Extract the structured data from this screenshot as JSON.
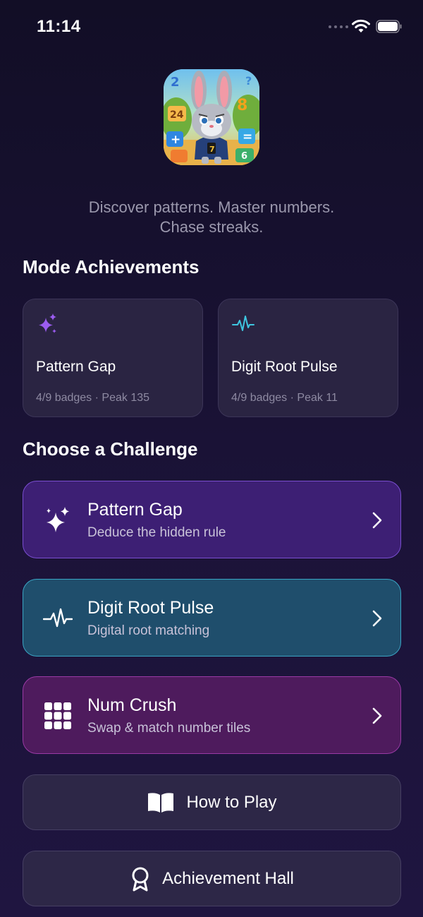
{
  "status": {
    "time": "11:14"
  },
  "header": {
    "tagline_line1": "Discover patterns. Master numbers.",
    "tagline_line2": "Chase streaks."
  },
  "achievements": {
    "title": "Mode Achievements",
    "cards": [
      {
        "name": "Pattern Gap",
        "stats": "4/9 badges · Peak 135",
        "icon": "sparkles-icon",
        "accent": "#9b5cf0"
      },
      {
        "name": "Digit Root Pulse",
        "stats": "4/9 badges · Peak 11",
        "icon": "pulse-icon",
        "accent": "#3ec6e0"
      }
    ]
  },
  "challenges": {
    "title": "Choose a Challenge",
    "items": [
      {
        "title": "Pattern Gap",
        "subtitle": "Deduce the hidden rule",
        "icon": "sparkles-icon",
        "color": "#3d1f74"
      },
      {
        "title": "Digit Root Pulse",
        "subtitle": "Digital root matching",
        "icon": "pulse-icon",
        "color": "#1f4e6c"
      },
      {
        "title": "Num Crush",
        "subtitle": "Swap & match number tiles",
        "icon": "grid-icon",
        "color": "#4e1b5d"
      }
    ]
  },
  "actions": {
    "how_to_play": "How to Play",
    "achievement_hall": "Achievement Hall"
  }
}
